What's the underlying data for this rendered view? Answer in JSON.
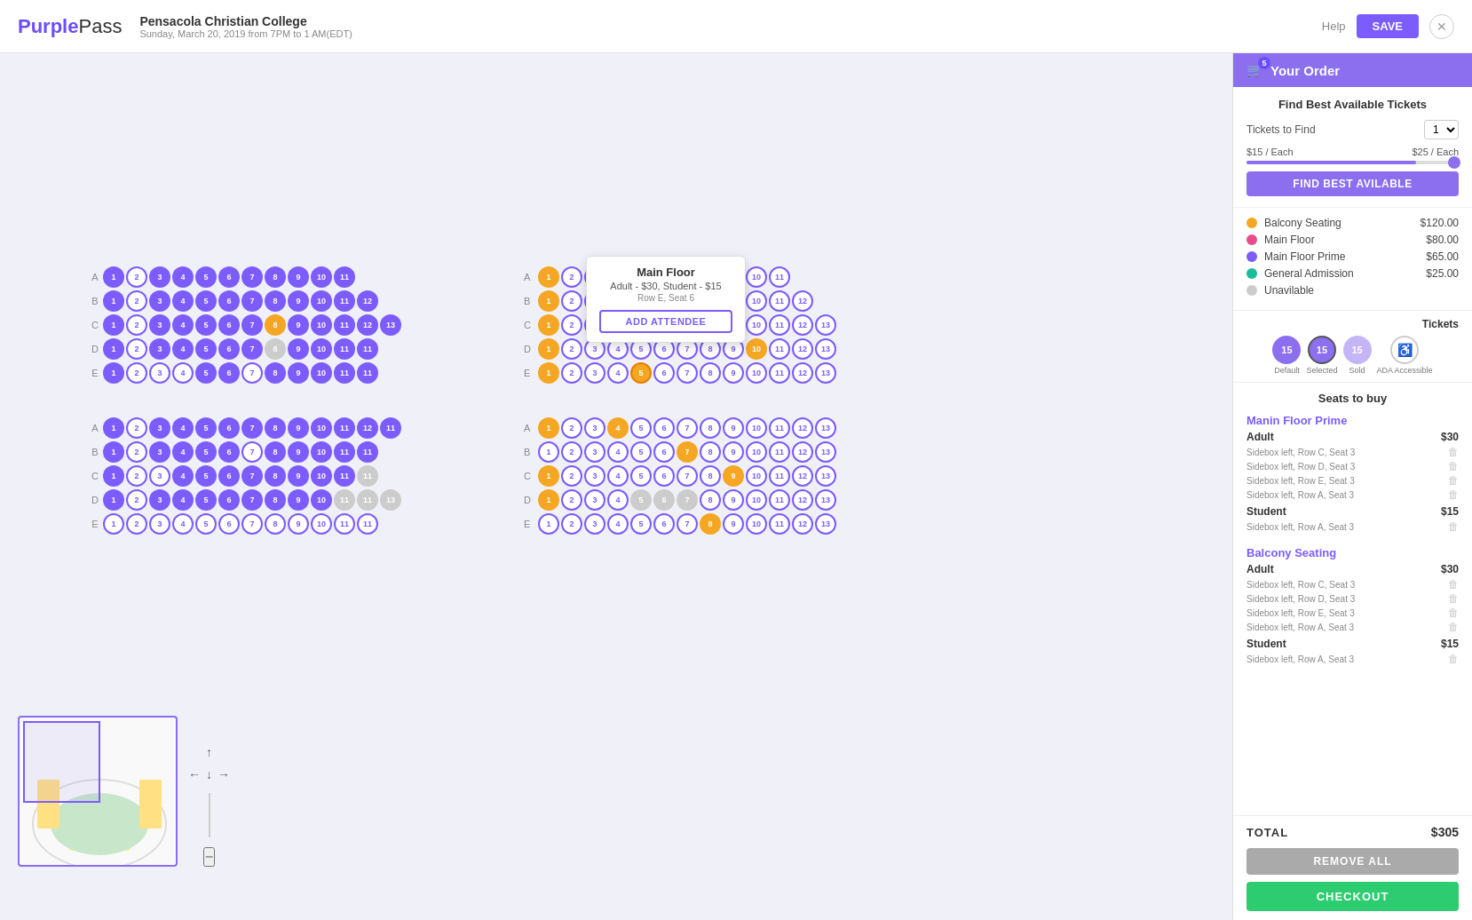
{
  "header": {
    "logo_purple": "Purple",
    "logo_light": "Pass",
    "event_title": "Pensacola Christian College",
    "event_date": "Sunday, March 20, 2019 from 7PM to 1 AM(EDT)",
    "help_label": "Help",
    "save_label": "SAVE"
  },
  "order": {
    "title": "Your Order",
    "cart_count": "5"
  },
  "find_tickets": {
    "title": "Find Best Available Tickets",
    "tickets_label": "Tickets to Find",
    "tickets_value": "1",
    "price_min": "$15 / Each",
    "price_max": "$25 / Each",
    "button_label": "FIND BEST AVILABLE"
  },
  "legend": [
    {
      "name": "Balcony Seating",
      "price": "$120.00",
      "color": "#f5a623"
    },
    {
      "name": "Main Floor",
      "price": "$80.00",
      "color": "#e74c8b"
    },
    {
      "name": "Main Floor Prime",
      "price": "$65.00",
      "color": "#7c5cfc"
    },
    {
      "name": "General Admission",
      "price": "$25.00",
      "color": "#1abc9c"
    },
    {
      "name": "Unavilable",
      "price": "",
      "color": "#ccc"
    }
  ],
  "ticket_icons": {
    "label": "Tickets",
    "items": [
      {
        "value": "15",
        "type": "default",
        "label": "Default"
      },
      {
        "value": "15",
        "type": "selected",
        "label": "Selected"
      },
      {
        "value": "15",
        "type": "sold",
        "label": "Sold"
      },
      {
        "value": "♿",
        "type": "ada",
        "label": "ADA Accessible"
      }
    ]
  },
  "seats_to_buy": {
    "title": "Seats to buy",
    "groups": [
      {
        "name": "Manin Floor Prime",
        "tiers": [
          {
            "name": "Adult",
            "price": "$30",
            "seats": [
              "Sidebox left, Row C, Seat 3",
              "Sidebox left, Row D, Seat 3",
              "Sidebox left, Row E, Seat 3",
              "Sidebox left, Row A, Seat 3"
            ]
          },
          {
            "name": "Student",
            "price": "$15",
            "seats": [
              "Sidebox left, Row A, Seat 3"
            ]
          }
        ]
      },
      {
        "name": "Balcony Seating",
        "tiers": [
          {
            "name": "Adult",
            "price": "$30",
            "seats": [
              "Sidebox left, Row C, Seat 3",
              "Sidebox left, Row D, Seat 3",
              "Sidebox left, Row E, Seat 3",
              "Sidebox left, Row A, Seat 3"
            ]
          },
          {
            "name": "Student",
            "price": "$15",
            "seats": [
              "Sidebox left, Row A, Seat 3"
            ]
          }
        ]
      }
    ]
  },
  "total": {
    "label": "TOTAL",
    "amount": "$305"
  },
  "remove_all_label": "REMOVE ALL",
  "checkout_label": "CHECKOUT",
  "tooltip": {
    "title": "Main Floor",
    "price": "Adult - $30, Student - $15",
    "location": "Row E, Seat 6",
    "button": "ADD ATTENDEE"
  },
  "colors": {
    "purple": "#7c5cfc",
    "accent": "#8b6fef",
    "green": "#2ecc71",
    "yellow": "#f5a623",
    "pink": "#e74c8b",
    "teal": "#1abc9c",
    "gray": "#ccc"
  }
}
